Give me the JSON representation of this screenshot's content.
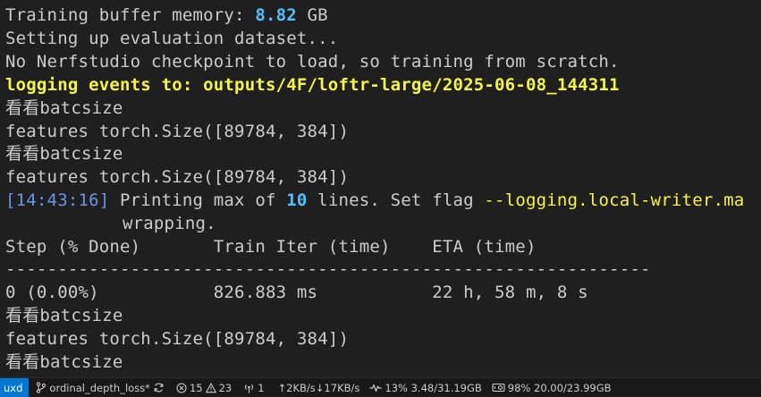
{
  "terminal": {
    "l1_label": "Training buffer memory: ",
    "l1_value": "8.82",
    "l1_unit": " GB",
    "l2": "Setting up evaluation dataset...",
    "l3": "No Nerfstudio checkpoint to load, so training from scratch.",
    "l4": "logging events to: outputs/4F/loftr-large/2025-06-08_144311",
    "l5": "看看batcsize",
    "l6": "features torch.Size([89784, 384])",
    "l7": "看看batcsize",
    "l8": "features torch.Size([89784, 384])",
    "l9_time": "[14:43:16]",
    "l9_a": " Printing max of ",
    "l9_num": "10",
    "l9_b": " lines. Set flag ",
    "l9_flag": "--logging.local-writer.ma",
    "l10": "wrapping.",
    "header": "Step (% Done)       Train Iter (time)    ETA (time)",
    "divider": "--------------------------------------------------------------",
    "row": "0 (0.00%)           826.883 ms           22 h, 58 m, 8 s",
    "l14": "看看batcsize",
    "l15": "features torch.Size([89784, 384])",
    "l16": "看看batcsize"
  },
  "statusbar": {
    "remote": "uxd",
    "branch": "ordinal_depth_loss*",
    "errors": "15",
    "warnings": "23",
    "ports": "1",
    "network": "↑2KB/s↓17KB/s",
    "cpu": "13% 3.48/31.19GB",
    "gpu": "98% 20.00/23.99GB"
  },
  "colors": {
    "background": "#1f1f1f",
    "text": "#cccccc",
    "accent_blue": "#4fc1ff",
    "yellow": "#f5f543",
    "remote_bg": "#0078d4"
  },
  "icons": [
    "branch-icon",
    "sync-icon",
    "error-icon",
    "warning-icon",
    "ports-icon",
    "pulse-icon",
    "gpu-icon"
  ]
}
